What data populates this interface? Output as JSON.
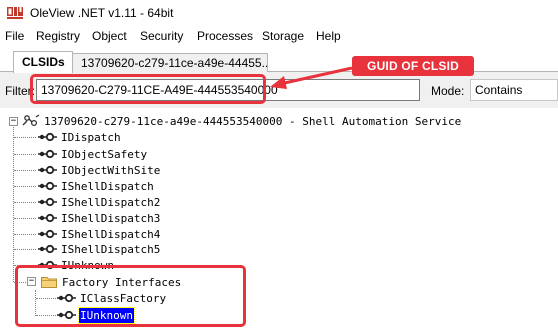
{
  "window": {
    "title": "OleView .NET v1.11 - 64bit"
  },
  "menu": {
    "items": [
      "File",
      "Registry",
      "Object",
      "Security",
      "Processes",
      "Storage",
      "Help"
    ]
  },
  "tabs": [
    {
      "label": "CLSIDs",
      "active": true
    },
    {
      "label": "13709620-c279-11ce-a49e-44455...",
      "active": false
    }
  ],
  "filter": {
    "label": "Filter:",
    "value": "13709620-C279-11CE-A49E-444553540000",
    "mode_label": "Mode:",
    "mode_value": "Contains"
  },
  "tree": {
    "root": "13709620-c279-11ce-a49e-444553540000 - Shell Automation Service",
    "interfaces": [
      "IDispatch",
      "IObjectSafety",
      "IObjectWithSite",
      "IShellDispatch",
      "IShellDispatch2",
      "IShellDispatch3",
      "IShellDispatch4",
      "IShellDispatch5",
      "IUnknown"
    ],
    "factory_folder": "Factory Interfaces",
    "factory_items": [
      "IClassFactory",
      "IUnknown"
    ]
  },
  "annotation": {
    "callout": "GUID OF CLSID",
    "color": "#e8323c"
  },
  "colors": {
    "selection": "#0000ff",
    "annotation_red": "#e8323c"
  }
}
